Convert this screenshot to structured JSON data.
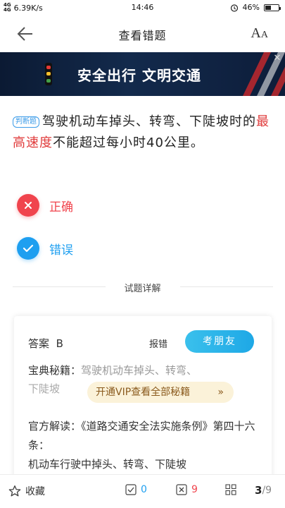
{
  "status_bar": {
    "signal_text": "4G 4G",
    "speed": "6.39K/s",
    "time": "14:46",
    "battery": "46%",
    "battery_level": 0.46
  },
  "nav": {
    "title": "查看错题",
    "font_icon_text_big": "A",
    "font_icon_text_small": "A"
  },
  "banner": {
    "text": "安全出行  文明交通"
  },
  "question": {
    "tag": "判断题",
    "text_before": "驾驶机动车掉头、转弯、下陡坡时的",
    "highlight": "最高速度",
    "text_after": "不能超过每小时40公里。"
  },
  "options": [
    {
      "label": "正确",
      "state": "wrong",
      "color": "#f0444d"
    },
    {
      "label": "错误",
      "state": "correct",
      "color": "#1e9ff0"
    }
  ],
  "explain": {
    "section_title": "试题详解",
    "answer_label": "答案",
    "answer_value": "B",
    "report_label": "报错",
    "exam_button": "考朋友",
    "tips_label": "宝典秘籍：",
    "tips_text_line1": "驾驶机动车掉头、转弯、",
    "tips_text_line2": "下陡坡",
    "vip_button": "开通VIP查看全部秘籍",
    "vip_arrow": "»",
    "official_label": "官方解读：",
    "official_text": "《道路交通安全法实施条例》第四十六条：",
    "official_text2": "机动车行驶中掉头、转弯、下陡坡"
  },
  "bottom_bar": {
    "favorite_label": "收藏",
    "correct_count": "0",
    "wrong_count": "9",
    "current_page": "3",
    "total_pages": "/9"
  },
  "colors": {
    "accent_blue": "#1ea8e6",
    "error_red": "#f0444d",
    "highlight_red": "#e03c3c"
  }
}
